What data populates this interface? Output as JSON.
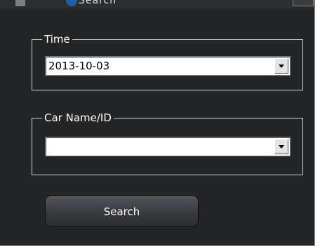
{
  "window": {
    "title_partial": "Search"
  },
  "time_group": {
    "legend": "Time",
    "selected_value": "2013-10-03"
  },
  "car_group": {
    "legend": "Car Name/ID",
    "selected_value": ""
  },
  "actions": {
    "search_label": "Search"
  },
  "icons": {
    "dropdown": "chevron-down-icon"
  }
}
